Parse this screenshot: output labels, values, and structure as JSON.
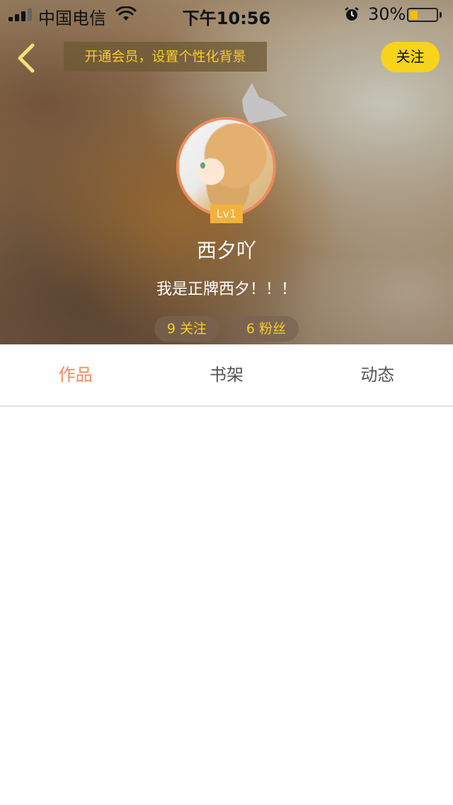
{
  "status_bar": {
    "carrier": "中国电信",
    "time": "下午10:56",
    "battery_percent": "30%",
    "battery_level": 0.3,
    "signal_bars": 4,
    "icons": [
      "signal-icon",
      "wifi-icon",
      "alarm-icon",
      "battery-icon"
    ]
  },
  "top_bar": {
    "back_icon": "chevron-left-icon",
    "vip_banner": "开通会员，设置个性化背景",
    "follow_label": "关注"
  },
  "profile": {
    "level": "Lv1",
    "username": "西夕吖",
    "bio": "我是正牌西夕！！！",
    "following": "9 关注",
    "fans": "6 粉丝"
  },
  "tabs": [
    {
      "label": "作品",
      "active": true
    },
    {
      "label": "书架",
      "active": false
    },
    {
      "label": "动态",
      "active": false
    }
  ],
  "colors": {
    "accent": "#f08a5d",
    "follow_button": "#f7d31b",
    "highlight_text": "#f5cd2a",
    "level_badge": "#f3b13c"
  }
}
